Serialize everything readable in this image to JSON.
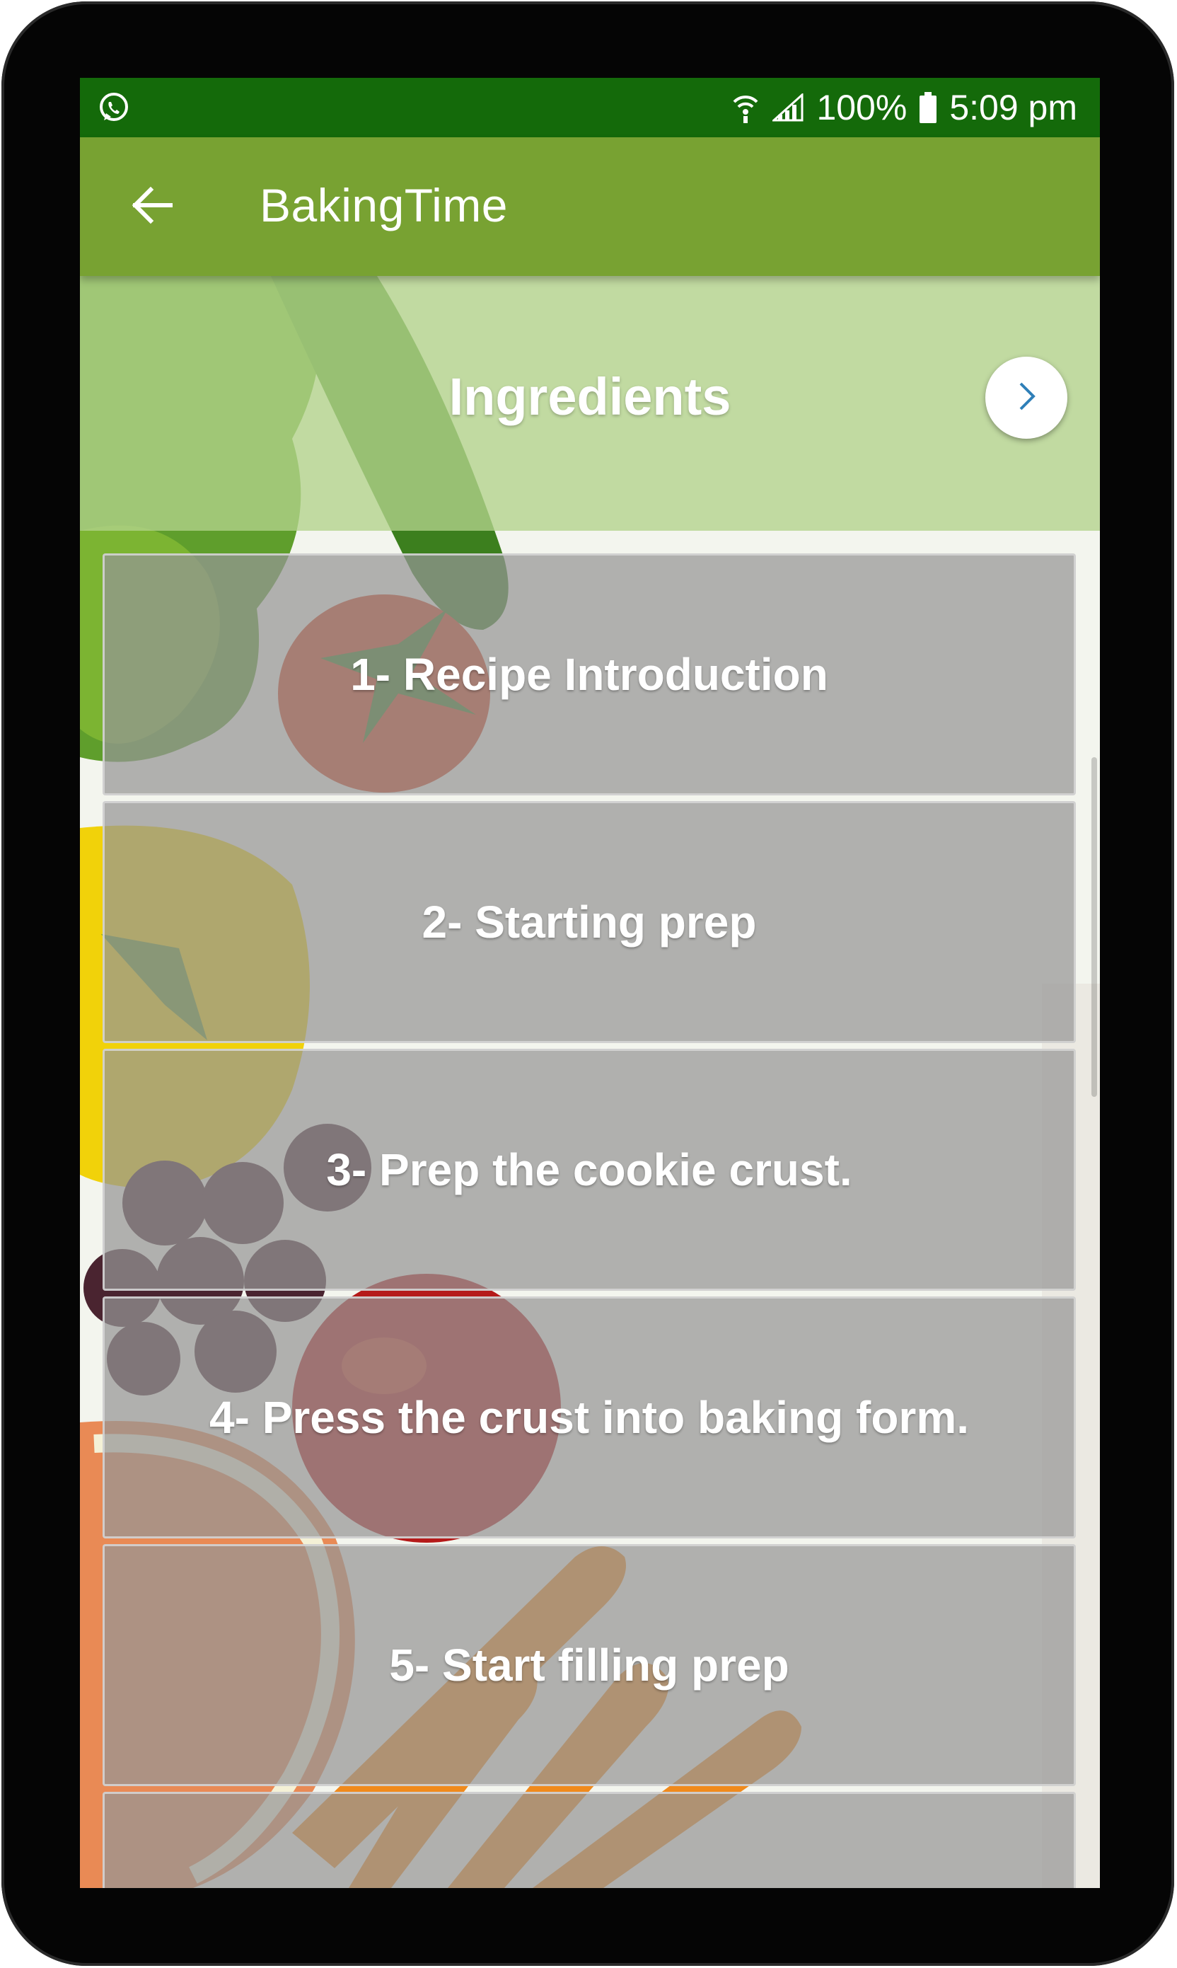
{
  "status_bar": {
    "battery": "100%",
    "time": "5:09 pm",
    "icons": [
      "whatsapp-icon",
      "wifi-icon",
      "signal-icon",
      "battery-icon"
    ]
  },
  "app_bar": {
    "title": "BakingTime",
    "back_icon": "arrow-left-icon"
  },
  "ingredients": {
    "title": "Ingredients",
    "next_icon": "chevron-right-icon"
  },
  "steps": [
    {
      "label": "1- Recipe Introduction"
    },
    {
      "label": "2- Starting prep"
    },
    {
      "label": "3- Prep the cookie crust."
    },
    {
      "label": "4- Press the crust into baking form."
    },
    {
      "label": "5- Start filling prep"
    },
    {
      "label": ""
    }
  ],
  "colors": {
    "status_bar": "#146a0a",
    "app_bar": "#78a232",
    "ingredients_bg": "#b2d28c",
    "card": "#969696",
    "accent": "#2f7fb8"
  }
}
